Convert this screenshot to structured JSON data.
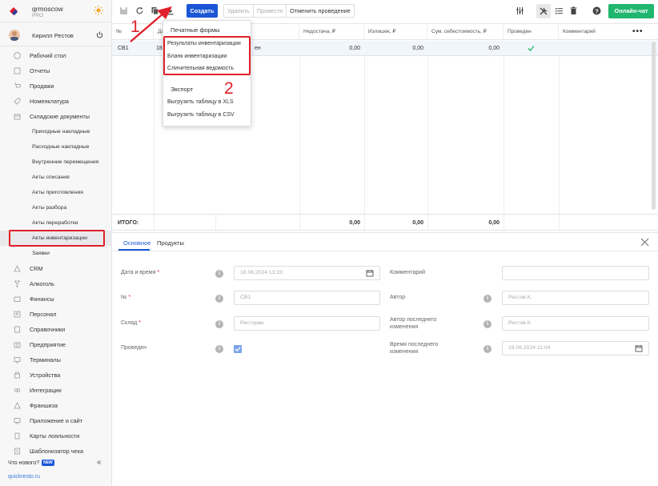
{
  "brand": {
    "name": "qrmoscow",
    "tier": "PRO"
  },
  "user": {
    "name": "Кирилл Рестов"
  },
  "nav": {
    "items": [
      {
        "label": "Рабочий стол",
        "icon": "dashboard-icon"
      },
      {
        "label": "Отчеты",
        "icon": "reports-icon"
      },
      {
        "label": "Продажи",
        "icon": "cart-icon"
      },
      {
        "label": "Номенклатура",
        "icon": "tag-icon"
      },
      {
        "label": "Складские документы",
        "icon": "box-icon"
      }
    ],
    "subitems": [
      "Приходные накладные",
      "Расходные накладные",
      "Внутренние перемещения",
      "Акты списания",
      "Акты приготовления",
      "Акты разбора",
      "Акты переработки",
      "Акты инвентаризации",
      "Заявки"
    ],
    "items2": [
      {
        "label": "CRM",
        "icon": "crm-icon"
      },
      {
        "label": "Алкоголь",
        "icon": "glass-icon"
      },
      {
        "label": "Финансы",
        "icon": "wallet-icon"
      },
      {
        "label": "Персонал",
        "icon": "person-icon"
      },
      {
        "label": "Справочники",
        "icon": "book-icon"
      },
      {
        "label": "Предприятие",
        "icon": "building-icon"
      },
      {
        "label": "Терминалы",
        "icon": "terminal-icon"
      },
      {
        "label": "Устройства",
        "icon": "device-icon"
      },
      {
        "label": "Интеграции",
        "icon": "link-icon"
      },
      {
        "label": "Франшиза",
        "icon": "franchise-icon"
      },
      {
        "label": "Приложение и сайт",
        "icon": "monitor-icon"
      },
      {
        "label": "Карты лояльности",
        "icon": "card-icon"
      },
      {
        "label": "Шаблонизатор чека",
        "icon": "receipt-icon"
      }
    ],
    "whats_new": "Что нового?",
    "new_badge": "NEW",
    "footer_link": "quickresto.ru"
  },
  "toolbar": {
    "create": "Создать",
    "delete": "Удалить",
    "post": "Провести",
    "unpost": "Отменить проведение",
    "chat": "Онлайн-чат"
  },
  "table": {
    "headers": [
      "№",
      "Да",
      "Недостача, ₽",
      "Излишек, ₽",
      "Сум. себестоимость, ₽",
      "Проведен",
      "Комментарий"
    ],
    "row": {
      "num": "СВ1",
      "date": "18",
      "place": "ен",
      "shortage": "0,00",
      "surplus": "0,00",
      "cost": "0,00"
    },
    "total": {
      "label": "ИТОГО:",
      "shortage": "0,00",
      "surplus": "0,00",
      "cost": "0,00"
    }
  },
  "dropdown": {
    "print_title": "Печатные формы",
    "print_items": [
      "Результаты инвентаризации",
      "Бланк инвентаризации",
      "Сличительная ведомость"
    ],
    "export_title": "Экспорт",
    "export_items": [
      "Выгрузить таблицу в XLS",
      "Выгрузить таблицу в CSV"
    ]
  },
  "annotations": {
    "one": "1",
    "two": "2"
  },
  "panel": {
    "tabs": [
      "Основное",
      "Продукты"
    ],
    "fields": {
      "datetime": {
        "label": "Дата и время",
        "value": "18.06.2024 13:23"
      },
      "number": {
        "label": "№",
        "value": "СВ1"
      },
      "warehouse": {
        "label": "Склад",
        "value": "Ресторан"
      },
      "posted": {
        "label": "Проведен"
      },
      "comment": {
        "label": "Комментарий",
        "value": ""
      },
      "author": {
        "label": "Автор",
        "value": "Рестов К."
      },
      "last_author": {
        "label": "Автор последнего изменения",
        "value": "Рестов К."
      },
      "last_time": {
        "label": "Время последнего изменения",
        "value": "19.06.2024 11:04"
      }
    },
    "required_mark": "*",
    "info_mark": "i"
  },
  "colors": {
    "accent": "#1a56d6",
    "chat": "#21b66f",
    "annotation": "#e0202a"
  }
}
